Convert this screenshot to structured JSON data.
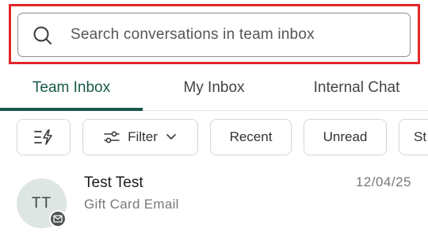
{
  "search": {
    "placeholder": "Search conversations in team inbox",
    "value": ""
  },
  "tabs": [
    {
      "label": "Team Inbox",
      "active": true
    },
    {
      "label": "My Inbox",
      "active": false
    },
    {
      "label": "Internal Chat",
      "active": false
    }
  ],
  "filters": {
    "quick_actions_icon": "bolt-list-icon",
    "filter_label": "Filter",
    "recent_label": "Recent",
    "unread_label": "Unread",
    "more_label": "St"
  },
  "conversations": [
    {
      "initials": "TT",
      "name": "Test Test",
      "preview": "Gift Card Email",
      "date": "12/04/25",
      "channel_icon": "email-icon"
    }
  ],
  "colors": {
    "accent": "#17594b",
    "highlight": "#e3262a",
    "avatar_bg": "#dde6e2"
  }
}
